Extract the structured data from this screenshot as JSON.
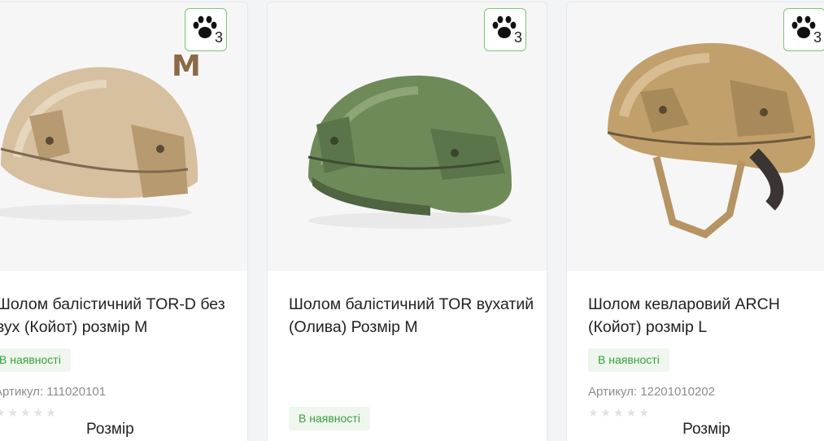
{
  "products": [
    {
      "title": "Шолом балістичний TOR-D без вух (Койот) розмір M",
      "title_visible": "Шолом балістичний TOR-D без\nвух (Койот) розмір M",
      "availability": "В наявності",
      "sku": "Артикул: 111020101",
      "size_label": "Розмір",
      "size_mark": "M",
      "paw_count": "3",
      "paw_icon": "paw-icon",
      "helmet_color": "#d1b891"
    },
    {
      "title": "Шолом балістичний TOR вухатий (Олива) Розмір M",
      "availability": "В наявності",
      "paw_count": "3",
      "paw_icon": "paw-icon",
      "helmet_color": "#6e8a57"
    },
    {
      "title": "Шолом кевларовий ARCH (Койот) розмір L",
      "availability": "В наявності",
      "sku": "Артикул: 12201010202",
      "size_label": "Розмір",
      "paw_count": "3",
      "paw_icon": "paw-icon",
      "helmet_color": "#bf9c68"
    }
  ],
  "colors": {
    "accent_green": "#3a9d3d",
    "badge_border": "#7cc576"
  }
}
